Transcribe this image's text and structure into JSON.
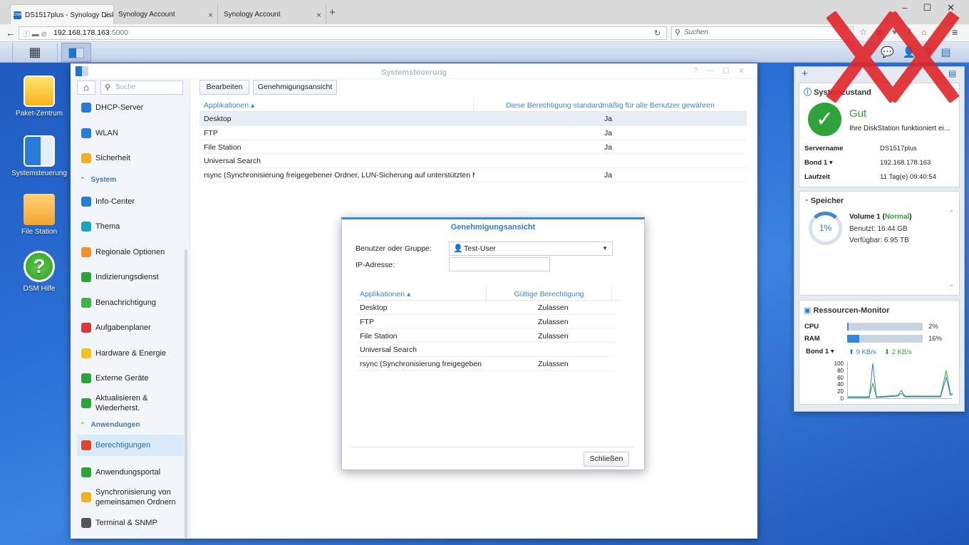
{
  "browser": {
    "tabs": [
      {
        "label": "DS1517plus - Synology Disk",
        "favicon": "DSM"
      },
      {
        "label": "Synology Account"
      },
      {
        "label": "Synology Account"
      }
    ],
    "new_tab": "+",
    "url_host": "192.168.178.163",
    "url_port": ":5000",
    "search_placeholder": "Suchen"
  },
  "window": {
    "title": "Systemsteuerung",
    "search_placeholder": "Suche"
  },
  "desktop": {
    "icons": [
      {
        "label": "Paket-Zentrum"
      },
      {
        "label": "Systemsteuerung"
      },
      {
        "label": "File Station"
      },
      {
        "label": "DSM Hilfe"
      }
    ]
  },
  "sidebar": {
    "items_top": [
      {
        "label": "DHCP-Server",
        "icon_color": "#2a7bd6"
      },
      {
        "label": "WLAN",
        "icon_color": "#2a7bd6"
      },
      {
        "label": "Sicherheit",
        "icon_color": "#f2b01e"
      }
    ],
    "section_system": "System",
    "items_system": [
      {
        "label": "Info-Center",
        "icon_color": "#2a7bd6"
      },
      {
        "label": "Thema",
        "icon_color": "#1fa3b8"
      },
      {
        "label": "Regionale Optionen",
        "icon_color": "#f2922e"
      },
      {
        "label": "Indizierungsdienst",
        "icon_color": "#2ea33a"
      },
      {
        "label": "Benachrichtigung",
        "icon_color": "#3fb24a"
      },
      {
        "label": "Aufgabenplaner",
        "icon_color": "#d83a3a"
      },
      {
        "label": "Hardware & Energie",
        "icon_color": "#f2c21e"
      },
      {
        "label": "Externe Geräte",
        "icon_color": "#2ea33a"
      },
      {
        "label": "Aktualisieren & Wiederherst.",
        "icon_color": "#2ea33a"
      }
    ],
    "section_apps": "Anwendungen",
    "items_apps": [
      {
        "label": "Berechtigungen",
        "icon_color": "#e0442d",
        "selected": true
      },
      {
        "label": "Anwendungsportal",
        "icon_color": "#2ea33a"
      },
      {
        "label": "Synchronisierung von gemeinsamen Ordnern",
        "icon_color": "#f2b01e"
      },
      {
        "label": "Terminal & SNMP",
        "icon_color": "#555555"
      }
    ]
  },
  "toolbar": {
    "edit_label": "Bearbeiten",
    "perm_view_label": "Genehmigungsansicht"
  },
  "app_grid": {
    "headers": [
      "Applikationen ▴",
      "Diese Berechtigung standardmäßig für alle Benutzer gewähren"
    ],
    "rows": [
      {
        "app": "Desktop",
        "default": "Ja"
      },
      {
        "app": "FTP",
        "default": "Ja"
      },
      {
        "app": "File Station",
        "default": "Ja"
      },
      {
        "app": "Universal Search",
        "default": ""
      },
      {
        "app": "rsync (Synchronisierung freigegebener Ordner, LUN-Sicherung auf unterstützten M...",
        "default": "Ja"
      }
    ]
  },
  "dialog": {
    "title": "Genehmigungsansicht",
    "user_group_label": "Benutzer oder Gruppe:",
    "user_group_value": "Test-User",
    "ip_label": "IP-Adresse:",
    "ip_value": "",
    "headers": [
      "Applikationen ▴",
      "Gültige Berechtigung"
    ],
    "rows": [
      {
        "app": "Desktop",
        "perm": "Zulassen"
      },
      {
        "app": "FTP",
        "perm": "Zulassen"
      },
      {
        "app": "File Station",
        "perm": "Zulassen"
      },
      {
        "app": "Universal Search",
        "perm": ""
      },
      {
        "app": "rsync (Synchronisierung freigegeben...",
        "perm": "Zulassen"
      }
    ],
    "close_label": "Schließen"
  },
  "widgets": {
    "status": {
      "title": "Systemzustand",
      "state": "Gut",
      "message": "Ihre DiskStation funktioniert ei...",
      "fields": [
        {
          "key": "Servername",
          "value": "DS1517plus"
        },
        {
          "key": "Bond 1 ▾",
          "value": "192.168.178.163"
        },
        {
          "key": "Laufzeit",
          "value": "11 Tag(e) 09:40:54"
        }
      ]
    },
    "storage": {
      "title": "Speicher",
      "percent_label": "1%",
      "volume": "Volume 1",
      "volume_state": "Normal",
      "used": "Benutzt: 16.44 GB",
      "free": "Verfügbar: 6.95 TB"
    },
    "monitor": {
      "title": "Ressourcen-Monitor",
      "cpu_label": "CPU",
      "cpu_value": "2%",
      "cpu_fraction": 0.02,
      "ram_label": "RAM",
      "ram_value": "16%",
      "ram_fraction": 0.16,
      "net_label": "Bond 1 ▾",
      "up": "9 KB/s",
      "down": "2 KB/s",
      "ticks": [
        "100",
        "80",
        "60",
        "40",
        "20",
        "0"
      ]
    }
  }
}
